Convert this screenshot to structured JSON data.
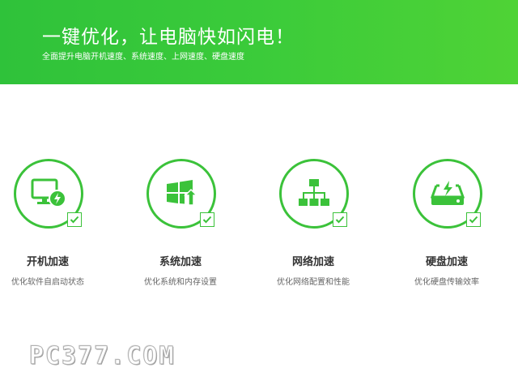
{
  "header": {
    "title": "一键优化，让电脑快如闪电！",
    "subtitle": "全面提升电脑开机速度、系统速度、上网速度、硬盘速度",
    "bg_color": "#3bc83a"
  },
  "features": [
    {
      "icon": "monitor-lightning-icon",
      "title": "开机加速",
      "desc": "优化软件自启动状态",
      "checked": true
    },
    {
      "icon": "windows-up-arrow-icon",
      "title": "系统加速",
      "desc": "优化系统和内存设置",
      "checked": true
    },
    {
      "icon": "network-topology-icon",
      "title": "网络加速",
      "desc": "优化网络配置和性能",
      "checked": true
    },
    {
      "icon": "harddisk-lightning-icon",
      "title": "硬盘加速",
      "desc": "优化硬盘传输效率",
      "checked": true
    }
  ],
  "watermark": {
    "text": "PC377.COM"
  },
  "colors": {
    "accent": "#3bc23a",
    "title_text": "#333333",
    "desc_text": "#666666"
  }
}
